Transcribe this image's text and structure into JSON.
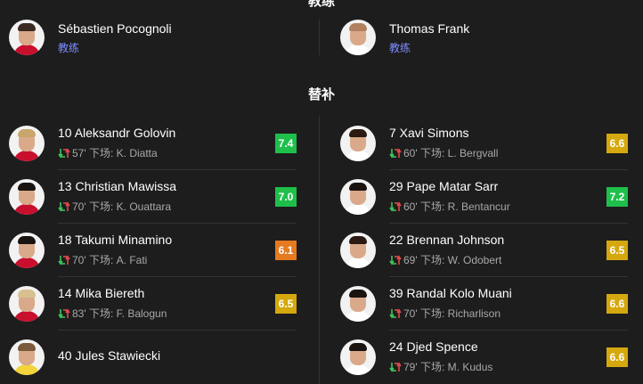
{
  "header": {
    "title": "教练"
  },
  "coaches": [
    {
      "name": "Sébastien Pocognoli",
      "role": "教练",
      "shirt": "#c8102e",
      "hair": "#3a2a22"
    },
    {
      "name": "Thomas Frank",
      "role": "教练",
      "shirt": "#ffffff",
      "hair": "#b08060"
    }
  ],
  "substitutes_title": "替补",
  "left_subs": [
    {
      "name": "10 Aleksandr Golovin",
      "minute": "57'",
      "replaced_label": "下场:",
      "replaced": "K. Diatta",
      "rating": "7.4",
      "rating_color": "#1fbf4c",
      "shirt": "#c8102e",
      "hair": "#c9a66b"
    },
    {
      "name": "13 Christian Mawissa",
      "minute": "70'",
      "replaced_label": "下场:",
      "replaced": "K. Ouattara",
      "rating": "7.0",
      "rating_color": "#1fbf4c",
      "shirt": "#c8102e",
      "hair": "#1a1410"
    },
    {
      "name": "18 Takumi Minamino",
      "minute": "70'",
      "replaced_label": "下场:",
      "replaced": "A. Fati",
      "rating": "6.1",
      "rating_color": "#e57a1f",
      "shirt": "#c8102e",
      "hair": "#1a1410"
    },
    {
      "name": "14 Mika Biereth",
      "minute": "83'",
      "replaced_label": "下场:",
      "replaced": "F. Balogun",
      "rating": "6.5",
      "rating_color": "#d4a80e",
      "shirt": "#c8102e",
      "hair": "#d8c090"
    },
    {
      "name": "40 Jules Stawiecki",
      "minute": "",
      "replaced_label": "",
      "replaced": "",
      "rating": "",
      "rating_color": "",
      "shirt": "#f2d33a",
      "hair": "#7a5a3a"
    }
  ],
  "right_subs": [
    {
      "name": "7 Xavi Simons",
      "minute": "60'",
      "replaced_label": "下场:",
      "replaced": "L. Bergvall",
      "rating": "6.6",
      "rating_color": "#d4a80e",
      "shirt": "#ffffff",
      "hair": "#2a1a12"
    },
    {
      "name": "29 Pape Matar Sarr",
      "minute": "60'",
      "replaced_label": "下场:",
      "replaced": "R. Bentancur",
      "rating": "7.2",
      "rating_color": "#1fbf4c",
      "shirt": "#ffffff",
      "hair": "#1a1410"
    },
    {
      "name": "22 Brennan Johnson",
      "minute": "69'",
      "replaced_label": "下场:",
      "replaced": "W. Odobert",
      "rating": "6.5",
      "rating_color": "#d4a80e",
      "shirt": "#ffffff",
      "hair": "#2a1a12"
    },
    {
      "name": "39 Randal Kolo Muani",
      "minute": "70'",
      "replaced_label": "下场:",
      "replaced": "Richarlison",
      "rating": "6.6",
      "rating_color": "#d4a80e",
      "shirt": "#ffffff",
      "hair": "#1a1410"
    },
    {
      "name": "24 Djed Spence",
      "minute": "79'",
      "replaced_label": "下场:",
      "replaced": "M. Kudus",
      "rating": "6.6",
      "rating_color": "#d4a80e",
      "shirt": "#ffffff",
      "hair": "#1a1410"
    }
  ]
}
